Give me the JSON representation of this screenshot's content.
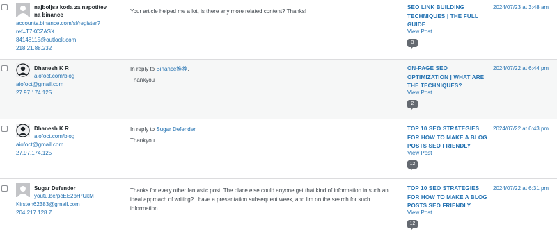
{
  "comments": [
    {
      "author": {
        "name": "najboljsa koda za napotitev na binance",
        "url": "accounts.binance.com/sl/register?ref=T7KCZASX",
        "url_lines": [
          "accounts.binance.com/sl/register?",
          "ref=T7KCZASX"
        ],
        "email": "84148115@outlook.com",
        "ip": "218.21.88.232",
        "avatar": "default-avatar"
      },
      "in_reply_to": null,
      "text": "Your article helped me a lot, is there any more related content? Thanks!",
      "post": {
        "title": "SEO LINK BUILDING TECHNIQUES | THE FULL GUIDE",
        "view": "View Post",
        "count": "3"
      },
      "date": "2024/07/23 at 3:48 am"
    },
    {
      "author": {
        "name": "Dhanesh K R",
        "url": "aiofoct.com/blog",
        "email": "aiofoct@gmail.com",
        "ip": "27.97.174.125",
        "avatar": "photo-avatar"
      },
      "in_reply_to": {
        "prefix": "In reply to",
        "target": "Binance推荐",
        "suffix": "."
      },
      "text": "Thankyou",
      "post": {
        "title": "ON-PAGE SEO OPTIMIZATION | WHAT ARE THE TECHNIQUES?",
        "view": "View Post",
        "count": "2"
      },
      "date": "2024/07/22 at 6:44 pm"
    },
    {
      "author": {
        "name": "Dhanesh K R",
        "url": "aiofoct.com/blog",
        "email": "aiofoct@gmail.com",
        "ip": "27.97.174.125",
        "avatar": "photo-avatar"
      },
      "in_reply_to": {
        "prefix": "In reply to",
        "target": "Sugar Defender",
        "suffix": "."
      },
      "text": "Thankyou",
      "post": {
        "title": "TOP 10 SEO STRATEGIES FOR HOW TO MAKE A BLOG POSTS SEO FRIENDLY",
        "view": "View Post",
        "count": "12"
      },
      "date": "2024/07/22 at 6:43 pm"
    },
    {
      "author": {
        "name": "Sugar Defender",
        "url": "youtu.be/pcEE2bHrUkM",
        "email": "Kirsten62383@gmail.com",
        "ip": "204.217.128.7",
        "avatar": "default-avatar"
      },
      "in_reply_to": null,
      "text": "Thanks for every other fantastic post. The place else could anyone get that kind of information in such an ideal approach of writing? I have a presentation subsequent week, and I'm on the search for such information.",
      "post": {
        "title": "TOP 10 SEO STRATEGIES FOR HOW TO MAKE A BLOG POSTS SEO FRIENDLY",
        "view": "View Post",
        "count": "12"
      },
      "date": "2024/07/22 at 6:31 pm"
    }
  ]
}
